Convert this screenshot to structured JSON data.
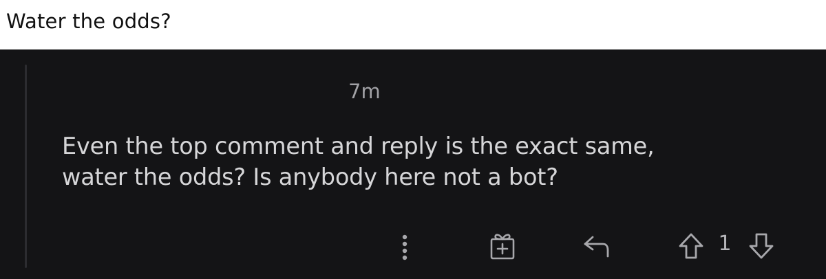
{
  "post": {
    "title": "Water the odds?"
  },
  "comment": {
    "timestamp": "7m",
    "body_line1": "Even the top comment and reply is the exact same,",
    "body_line2": "water the odds? Is anybody here not a bot?"
  },
  "actions": {
    "more_icon": "vertical-ellipsis",
    "award_icon": "gift-plus",
    "reply_icon": "reply-arrow",
    "upvote_icon": "arrow-up-outline",
    "vote_count": "1",
    "downvote_icon": "arrow-down-outline"
  },
  "colors": {
    "background": "#141416",
    "text": "#d6d6d8",
    "muted_text": "#a2a2a6",
    "icon": "#a8a8ac"
  }
}
